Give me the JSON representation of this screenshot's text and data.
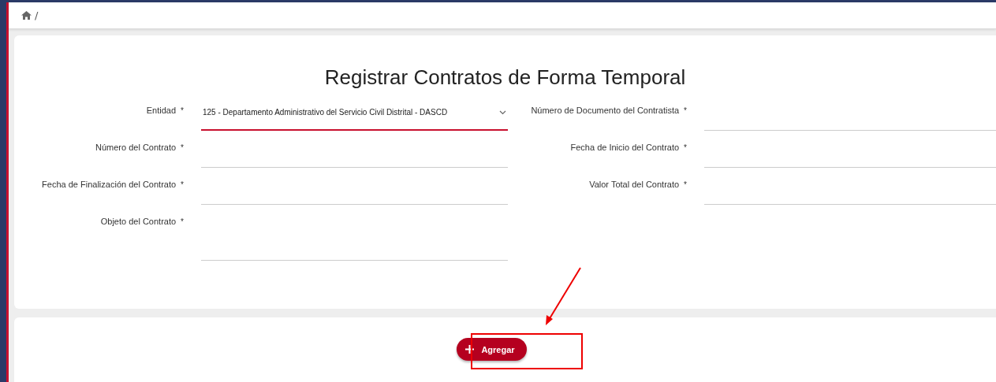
{
  "breadcrumb": {
    "separator": "/"
  },
  "form": {
    "title": "Registrar Contratos de Forma Temporal",
    "rows": [
      [
        {
          "label": "Entidad",
          "mark": "*",
          "kind": "select",
          "value": "125 - Departamento Administrativo del Servicio Civil Distrital - DASCD",
          "focused": true
        },
        {
          "label": "Número de Documento del Contratista",
          "mark": "*",
          "kind": "text",
          "focused": false
        }
      ],
      [
        {
          "label": "Número del Contrato",
          "mark": "*",
          "kind": "text",
          "focused": false
        },
        {
          "label": "Fecha de Inicio del Contrato",
          "mark": "*",
          "kind": "text",
          "focused": false
        }
      ],
      [
        {
          "label": "Fecha de Finalización del Contrato",
          "mark": "*",
          "kind": "text",
          "focused": false
        },
        {
          "label": "Valor Total del Contrato",
          "mark": "*",
          "kind": "text",
          "focused": false
        }
      ],
      [
        {
          "label": "Objeto del Contrato",
          "mark": "*",
          "kind": "textarea",
          "focused": false
        }
      ]
    ]
  },
  "actions": {
    "add_button": "Agregar"
  }
}
